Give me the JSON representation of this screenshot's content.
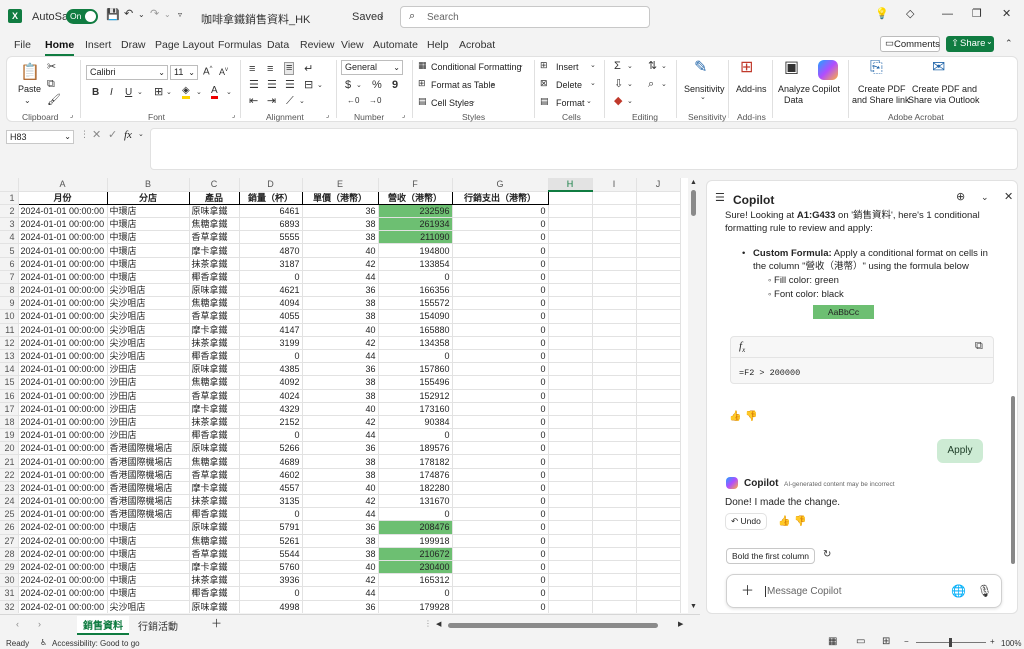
{
  "titlebar": {
    "autosave_label": "AutoSave",
    "autosave_state": "On",
    "file_name": "咖啡拿鐵銷售資料_HK",
    "saved_label": "Saved",
    "search_placeholder": "Search"
  },
  "tabs": [
    "File",
    "Home",
    "Insert",
    "Draw",
    "Page Layout",
    "Formulas",
    "Data",
    "Review",
    "View",
    "Automate",
    "Help",
    "Acrobat"
  ],
  "active_tab": "Home",
  "ribbon_right": {
    "comments_label": "Comments",
    "share_label": "Share"
  },
  "ribbon": {
    "clipboard": {
      "paste_label": "Paste",
      "group": "Clipboard"
    },
    "font": {
      "font_name": "Calibri",
      "font_size": "11",
      "group": "Font"
    },
    "alignment": {
      "group": "Alignment"
    },
    "number": {
      "format": "General",
      "group": "Number"
    },
    "styles": {
      "conditional_formatting": "Conditional Formatting",
      "format_as_table": "Format as Table",
      "cell_styles": "Cell Styles",
      "group": "Styles"
    },
    "cells": {
      "insert": "Insert",
      "delete": "Delete",
      "format": "Format",
      "group": "Cells"
    },
    "editing": {
      "group": "Editing"
    },
    "sensitivity": {
      "label": "Sensitivity",
      "group": "Sensitivity"
    },
    "addins": {
      "label": "Add-ins",
      "group": "Add-ins"
    },
    "analyze": {
      "analyze_label1": "Analyze",
      "analyze_label2": "Data",
      "copilot_label": "Copilot"
    },
    "acrobat": {
      "create1a": "Create PDF",
      "create1b": "and Share link",
      "create2a": "Create PDF and",
      "create2b": "Share via Outlook",
      "group": "Adobe Acrobat"
    }
  },
  "formula_bar": {
    "name_box": "H83",
    "fx": "fx",
    "value": ""
  },
  "grid": {
    "columns": [
      "A",
      "B",
      "C",
      "D",
      "E",
      "F",
      "G",
      "H",
      "I",
      "J"
    ],
    "headers": [
      "月份",
      "分店",
      "產品",
      "銷量（杯）",
      "單價（港幣）",
      "營收（港幣）",
      "行銷支出（港幣）"
    ],
    "rows": [
      [
        "2024-01-01 00:00:00",
        "中環店",
        "原味拿鐵",
        "6461",
        "36",
        "232596",
        "0"
      ],
      [
        "2024-01-01 00:00:00",
        "中環店",
        "焦糖拿鐵",
        "6893",
        "38",
        "261934",
        "0"
      ],
      [
        "2024-01-01 00:00:00",
        "中環店",
        "香草拿鐵",
        "5555",
        "38",
        "211090",
        "0"
      ],
      [
        "2024-01-01 00:00:00",
        "中環店",
        "摩卡拿鐵",
        "4870",
        "40",
        "194800",
        "0"
      ],
      [
        "2024-01-01 00:00:00",
        "中環店",
        "抹茶拿鐵",
        "3187",
        "42",
        "133854",
        "0"
      ],
      [
        "2024-01-01 00:00:00",
        "中環店",
        "椰香拿鐵",
        "0",
        "44",
        "0",
        "0"
      ],
      [
        "2024-01-01 00:00:00",
        "尖沙咀店",
        "原味拿鐵",
        "4621",
        "36",
        "166356",
        "0"
      ],
      [
        "2024-01-01 00:00:00",
        "尖沙咀店",
        "焦糖拿鐵",
        "4094",
        "38",
        "155572",
        "0"
      ],
      [
        "2024-01-01 00:00:00",
        "尖沙咀店",
        "香草拿鐵",
        "4055",
        "38",
        "154090",
        "0"
      ],
      [
        "2024-01-01 00:00:00",
        "尖沙咀店",
        "摩卡拿鐵",
        "4147",
        "40",
        "165880",
        "0"
      ],
      [
        "2024-01-01 00:00:00",
        "尖沙咀店",
        "抹茶拿鐵",
        "3199",
        "42",
        "134358",
        "0"
      ],
      [
        "2024-01-01 00:00:00",
        "尖沙咀店",
        "椰香拿鐵",
        "0",
        "44",
        "0",
        "0"
      ],
      [
        "2024-01-01 00:00:00",
        "沙田店",
        "原味拿鐵",
        "4385",
        "36",
        "157860",
        "0"
      ],
      [
        "2024-01-01 00:00:00",
        "沙田店",
        "焦糖拿鐵",
        "4092",
        "38",
        "155496",
        "0"
      ],
      [
        "2024-01-01 00:00:00",
        "沙田店",
        "香草拿鐵",
        "4024",
        "38",
        "152912",
        "0"
      ],
      [
        "2024-01-01 00:00:00",
        "沙田店",
        "摩卡拿鐵",
        "4329",
        "40",
        "173160",
        "0"
      ],
      [
        "2024-01-01 00:00:00",
        "沙田店",
        "抹茶拿鐵",
        "2152",
        "42",
        "90384",
        "0"
      ],
      [
        "2024-01-01 00:00:00",
        "沙田店",
        "椰香拿鐵",
        "0",
        "44",
        "0",
        "0"
      ],
      [
        "2024-01-01 00:00:00",
        "香港國際機場店",
        "原味拿鐵",
        "5266",
        "36",
        "189576",
        "0"
      ],
      [
        "2024-01-01 00:00:00",
        "香港國際機場店",
        "焦糖拿鐵",
        "4689",
        "38",
        "178182",
        "0"
      ],
      [
        "2024-01-01 00:00:00",
        "香港國際機場店",
        "香草拿鐵",
        "4602",
        "38",
        "174876",
        "0"
      ],
      [
        "2024-01-01 00:00:00",
        "香港國際機場店",
        "摩卡拿鐵",
        "4557",
        "40",
        "182280",
        "0"
      ],
      [
        "2024-01-01 00:00:00",
        "香港國際機場店",
        "抹茶拿鐵",
        "3135",
        "42",
        "131670",
        "0"
      ],
      [
        "2024-01-01 00:00:00",
        "香港國際機場店",
        "椰香拿鐵",
        "0",
        "44",
        "0",
        "0"
      ],
      [
        "2024-02-01 00:00:00",
        "中環店",
        "原味拿鐵",
        "5791",
        "36",
        "208476",
        "0"
      ],
      [
        "2024-02-01 00:00:00",
        "中環店",
        "焦糖拿鐵",
        "5261",
        "38",
        "199918",
        "0"
      ],
      [
        "2024-02-01 00:00:00",
        "中環店",
        "香草拿鐵",
        "5544",
        "38",
        "210672",
        "0"
      ],
      [
        "2024-02-01 00:00:00",
        "中環店",
        "摩卡拿鐵",
        "5760",
        "40",
        "230400",
        "0"
      ],
      [
        "2024-02-01 00:00:00",
        "中環店",
        "抹茶拿鐵",
        "3936",
        "42",
        "165312",
        "0"
      ],
      [
        "2024-02-01 00:00:00",
        "中環店",
        "椰香拿鐵",
        "0",
        "44",
        "0",
        "0"
      ],
      [
        "2024-02-01 00:00:00",
        "尖沙咀店",
        "原味拿鐵",
        "4998",
        "36",
        "179928",
        "0"
      ]
    ],
    "highlight_color": "#6dbf72"
  },
  "sheet_tabs": [
    "銷售資料",
    "行銷活動"
  ],
  "active_sheet": "銷售資料",
  "status": {
    "ready": "Ready",
    "accessibility": "Accessibility: Good to go",
    "zoom": "100%"
  },
  "copilot": {
    "title": "Copilot",
    "intro_pre": "Sure! Looking at ",
    "intro_range": "A1:G433",
    "intro_mid": " on '銷售資料', here's 1 conditional formatting rule to review and apply:",
    "rule_title": "Custom Formula:",
    "rule_text": " Apply a conditional format on cells in the column \"營收（港幣）\" using the formula below",
    "fill": "Fill color: green",
    "font": "Font color: black",
    "preview": "AaBbCc",
    "formula": "=F2 > 200000",
    "apply": "Apply",
    "reply_name": "Copilot",
    "disclaimer": "AI-generated content may be incorrect",
    "done": "Done! I made the change.",
    "undo": "Undo",
    "suggestion": "Bold the first column",
    "message_placeholder": "Message Copilot"
  }
}
